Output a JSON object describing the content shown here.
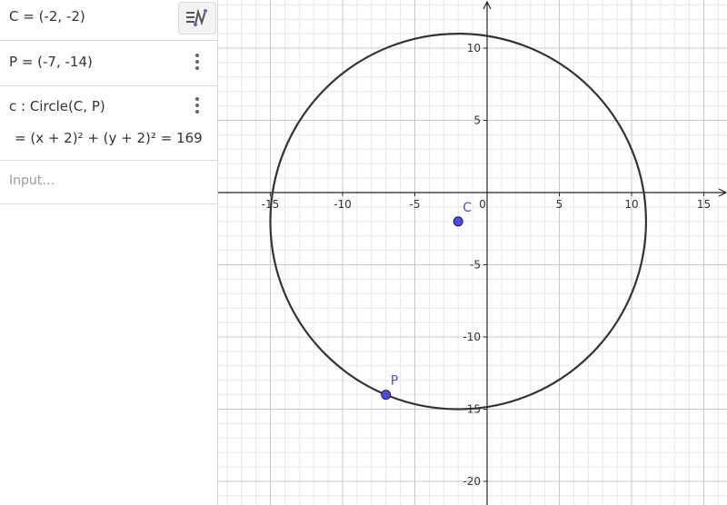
{
  "algebra_view": {
    "entries": [
      {
        "id": "C",
        "text": "C = (-2, -2)"
      },
      {
        "id": "P",
        "text": "P = (-7, -14)"
      },
      {
        "id": "c",
        "text": "c : Circle(C, P)",
        "value": "=  (x + 2)² + (y + 2)² = 169"
      }
    ],
    "input_placeholder": "Input…",
    "styling_bar_icon": "algebra-styling-icon",
    "more_icon": "vertical-dots-icon"
  },
  "graphics_view": {
    "grid": true,
    "x_ticks": [
      "-15",
      "-10",
      "-5",
      "0",
      "5",
      "10",
      "15"
    ],
    "y_ticks": [
      "10",
      "5",
      "-5",
      "-10",
      "-15",
      "-20"
    ],
    "points": [
      {
        "name": "C",
        "x": -2,
        "y": -2,
        "color": "#4c4cd8"
      },
      {
        "name": "P",
        "x": -7,
        "y": -14,
        "color": "#4c4cd8"
      }
    ],
    "circle": {
      "name": "c",
      "center": [
        -2,
        -2
      ],
      "radius": 13,
      "color": "#333333"
    }
  }
}
